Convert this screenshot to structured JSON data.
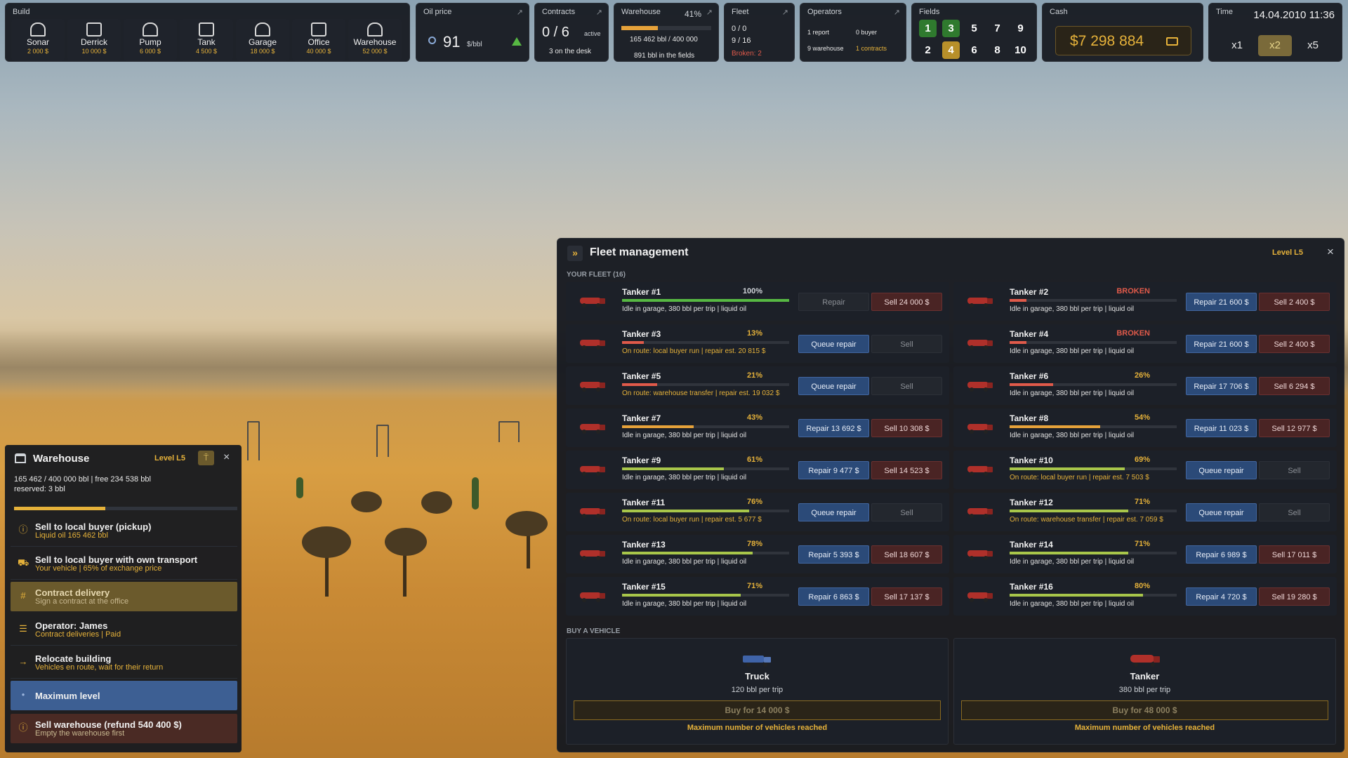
{
  "build": {
    "title": "Build",
    "items": [
      {
        "name": "Sonar",
        "price": "2 000 $",
        "icon": "sonar-icon"
      },
      {
        "name": "Derrick",
        "price": "10 000 $",
        "icon": "derrick-icon"
      },
      {
        "name": "Pump",
        "price": "6 000 $",
        "icon": "pump-icon"
      },
      {
        "name": "Tank",
        "price": "4 500 $",
        "icon": "tank-icon"
      },
      {
        "name": "Garage",
        "price": "18 000 $",
        "icon": "garage-icon"
      },
      {
        "name": "Office",
        "price": "40 000 $",
        "icon": "office-icon"
      },
      {
        "name": "Warehouse",
        "price": "52 000 $",
        "icon": "warehouse-icon"
      }
    ]
  },
  "oil": {
    "title": "Oil price",
    "value": "91",
    "unit": "$/bbl",
    "trend": "up"
  },
  "contracts": {
    "title": "Contracts",
    "value": "0 / 6",
    "active": "active",
    "desk": "3 on the desk"
  },
  "warehouse_stat": {
    "title": "Warehouse",
    "pct": "41%",
    "fill": 0.41,
    "amount": "165 462 bbl / 400 000",
    "fields": "891 bbl in the fields"
  },
  "fleet_stat": {
    "title": "Fleet",
    "l1": "0 / 0",
    "l2": "9 / 16",
    "broken": "Broken: 2"
  },
  "operators": {
    "title": "Operators",
    "report": "1 report",
    "buyer": "0 buyer",
    "warehouse": "9 warehouse",
    "contracts": "1 contracts"
  },
  "fields": {
    "title": "Fields",
    "top": [
      "1",
      "3",
      "5",
      "7",
      "9"
    ],
    "bottom": [
      "2",
      "4",
      "6",
      "8",
      "10"
    ]
  },
  "cash": {
    "title": "Cash",
    "value": "$7 298 884"
  },
  "time": {
    "title": "Time",
    "datetime": "14.04.2010 11:36",
    "speeds": [
      "x1",
      "x2",
      "x5"
    ],
    "active": "x2"
  },
  "fleet": {
    "arrow": "»",
    "title": "Fleet management",
    "level": "Level L5",
    "close": "×",
    "section": "YOUR FLEET (16)",
    "buy_section": "BUY A VEHICLE",
    "vehicles": [
      {
        "name": "Tanker #1",
        "pct": "100%",
        "cond": 1.0,
        "status": "Idle in garage, 380 bbl per trip | liquid oil",
        "b1": "Repair",
        "b1s": "gray",
        "b2": "Sell 24 000 $",
        "b2s": "red",
        "st": "idle"
      },
      {
        "name": "Tanker #2",
        "pct": "BROKEN",
        "cond": 0.1,
        "status": "Idle in garage, 380 bbl per trip | liquid oil",
        "b1": "Repair 21 600 $",
        "b1s": "blue",
        "b2": "Sell 2 400 $",
        "b2s": "red",
        "st": "idle"
      },
      {
        "name": "Tanker #3",
        "pct": "13%",
        "cond": 0.13,
        "status": "On route: local buyer run | repair est. 20 815 $",
        "b1": "Queue repair",
        "b1s": "blue",
        "b2": "Sell",
        "b2s": "gray",
        "st": "route"
      },
      {
        "name": "Tanker #4",
        "pct": "BROKEN",
        "cond": 0.1,
        "status": "Idle in garage, 380 bbl per trip | liquid oil",
        "b1": "Repair 21 600 $",
        "b1s": "blue",
        "b2": "Sell 2 400 $",
        "b2s": "red",
        "st": "idle"
      },
      {
        "name": "Tanker #5",
        "pct": "21%",
        "cond": 0.21,
        "status": "On route: warehouse transfer | repair est. 19 032 $",
        "b1": "Queue repair",
        "b1s": "blue",
        "b2": "Sell",
        "b2s": "gray",
        "st": "route"
      },
      {
        "name": "Tanker #6",
        "pct": "26%",
        "cond": 0.26,
        "status": "Idle in garage, 380 bbl per trip | liquid oil",
        "b1": "Repair 17 706 $",
        "b1s": "blue",
        "b2": "Sell 6 294 $",
        "b2s": "red",
        "st": "idle"
      },
      {
        "name": "Tanker #7",
        "pct": "43%",
        "cond": 0.43,
        "status": "Idle in garage, 380 bbl per trip | liquid oil",
        "b1": "Repair 13 692 $",
        "b1s": "blue",
        "b2": "Sell 10 308 $",
        "b2s": "red",
        "st": "idle"
      },
      {
        "name": "Tanker #8",
        "pct": "54%",
        "cond": 0.54,
        "status": "Idle in garage, 380 bbl per trip | liquid oil",
        "b1": "Repair 11 023 $",
        "b1s": "blue",
        "b2": "Sell 12 977 $",
        "b2s": "red",
        "st": "idle"
      },
      {
        "name": "Tanker #9",
        "pct": "61%",
        "cond": 0.61,
        "status": "Idle in garage, 380 bbl per trip | liquid oil",
        "b1": "Repair 9 477 $",
        "b1s": "blue",
        "b2": "Sell 14 523 $",
        "b2s": "red",
        "st": "idle"
      },
      {
        "name": "Tanker #10",
        "pct": "69%",
        "cond": 0.69,
        "status": "On route: local buyer run | repair est. 7 503 $",
        "b1": "Queue repair",
        "b1s": "blue",
        "b2": "Sell",
        "b2s": "gray",
        "st": "route"
      },
      {
        "name": "Tanker #11",
        "pct": "76%",
        "cond": 0.76,
        "status": "On route: local buyer run | repair est. 5 677 $",
        "b1": "Queue repair",
        "b1s": "blue",
        "b2": "Sell",
        "b2s": "gray",
        "st": "route"
      },
      {
        "name": "Tanker #12",
        "pct": "71%",
        "cond": 0.71,
        "status": "On route: warehouse transfer | repair est. 7 059 $",
        "b1": "Queue repair",
        "b1s": "blue",
        "b2": "Sell",
        "b2s": "gray",
        "st": "route"
      },
      {
        "name": "Tanker #13",
        "pct": "78%",
        "cond": 0.78,
        "status": "Idle in garage, 380 bbl per trip | liquid oil",
        "b1": "Repair 5 393 $",
        "b1s": "blue",
        "b2": "Sell 18 607 $",
        "b2s": "red",
        "st": "idle"
      },
      {
        "name": "Tanker #14",
        "pct": "71%",
        "cond": 0.71,
        "status": "Idle in garage, 380 bbl per trip | liquid oil",
        "b1": "Repair 6 989 $",
        "b1s": "blue",
        "b2": "Sell 17 011 $",
        "b2s": "red",
        "st": "idle"
      },
      {
        "name": "Tanker #15",
        "pct": "71%",
        "cond": 0.71,
        "status": "Idle in garage, 380 bbl per trip | liquid oil",
        "b1": "Repair 6 863 $",
        "b1s": "blue",
        "b2": "Sell 17 137 $",
        "b2s": "red",
        "st": "idle"
      },
      {
        "name": "Tanker #16",
        "pct": "80%",
        "cond": 0.8,
        "status": "Idle in garage, 380 bbl per trip | liquid oil",
        "b1": "Repair 4 720 $",
        "b1s": "blue",
        "b2": "Sell 19 280 $",
        "b2s": "red",
        "st": "idle"
      }
    ],
    "buy": [
      {
        "name": "Truck",
        "cap": "120 bbl per trip",
        "btn": "Buy for 14 000 $",
        "note": "Maximum number of vehicles reached",
        "icon": "truck-icon"
      },
      {
        "name": "Tanker",
        "cap": "380 bbl per trip",
        "btn": "Buy for 48 000 $",
        "note": "Maximum number of vehicles reached",
        "icon": "tanker-icon"
      }
    ]
  },
  "warehouse": {
    "title": "Warehouse",
    "level": "Level L5",
    "close": "×",
    "line1": "165 462 / 400 000 bbl | free 234 538 bbl",
    "line2": "reserved: 3 bbl",
    "fill": 0.41,
    "options": [
      {
        "t": "Sell to local buyer (pickup)",
        "s": "Liquid oil 165 462 bbl",
        "icon": "info-icon",
        "bg": ""
      },
      {
        "t": "Sell to local buyer with own transport",
        "s": "Your vehicle | 65% of exchange price",
        "icon": "truck-icon",
        "bg": ""
      },
      {
        "t": "Contract delivery",
        "s": "Sign a contract at the office",
        "icon": "hash-icon",
        "bg": "#6b5a2c"
      },
      {
        "t": "Operator: James",
        "s": "Contract deliveries | Paid",
        "icon": "operator-icon",
        "bg": ""
      },
      {
        "t": "Relocate building",
        "s": "Vehicles en route, wait for their return",
        "icon": "arrow-icon",
        "bg": ""
      },
      {
        "t": "Maximum level",
        "s": "",
        "icon": "dot-icon",
        "bg": "#3d5f93"
      },
      {
        "t": "Sell warehouse (refund 540 400 $)",
        "s": "Empty the warehouse first",
        "icon": "info-icon",
        "bg": "#4a2a24"
      }
    ]
  },
  "colors": {
    "accent": "#e6b23a",
    "danger": "#e05a4a",
    "ok": "#7fd65a",
    "blue": "#2b4a78"
  }
}
